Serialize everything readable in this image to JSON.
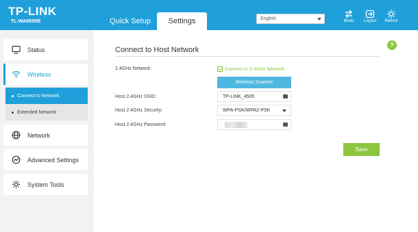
{
  "brand": {
    "logo": "TP-LINK",
    "model": "TL-WA855RE"
  },
  "tabs": {
    "quick_setup": "Quick Setup",
    "settings": "Settings"
  },
  "language": {
    "selected": "English"
  },
  "header_buttons": {
    "mode": "Mode",
    "logout": "Logout",
    "reboot": "Reboot"
  },
  "sidebar": {
    "status": "Status",
    "wireless": "Wireless",
    "connect_to_network": "Connect to Network",
    "extended_network": "Extended Network",
    "network": "Network",
    "advanced_settings": "Advanced Settings",
    "system_tools": "System Tools"
  },
  "main": {
    "title": "Connect to Host Network",
    "help": "?",
    "network_label": "2.4GHz Network:",
    "network_checkbox": "Connect to 2.4GHz Network",
    "scanner_button": "Wireless Scanner",
    "ssid_label": "Host 2.4GHz SSID:",
    "ssid_value": "TP-LINK_4505",
    "security_label": "Host 2.4GHz Security:",
    "security_value": "WPA-PSK/WPA2-PSK",
    "password_label": "Host 2.4GHz Password:",
    "save_button": "Save"
  },
  "colors": {
    "brand_blue": "#1fa0da",
    "accent_green": "#8cc63f"
  }
}
